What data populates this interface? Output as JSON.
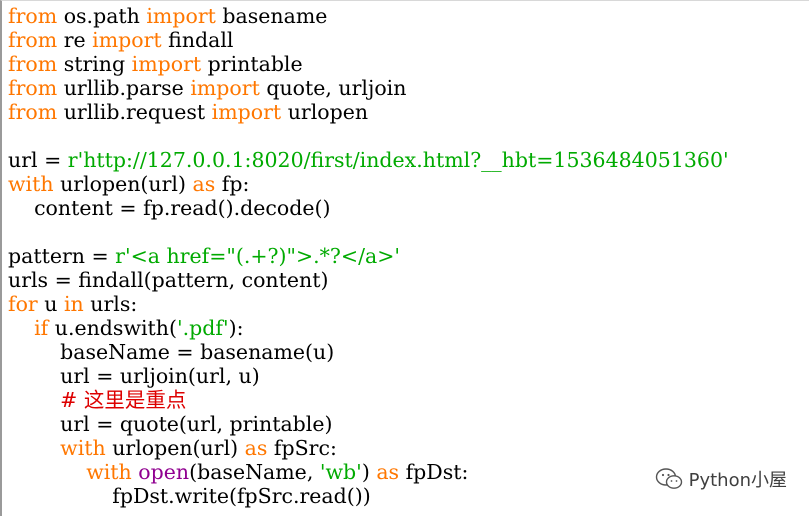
{
  "colors": {
    "keyword": "#ff7700",
    "string": "#00aa00",
    "builtin": "#900090",
    "comment": "#dd0000",
    "plain": "#000000",
    "background": "#ffffff"
  },
  "code": {
    "lines": [
      [
        {
          "t": "from",
          "c": "kw"
        },
        {
          "t": " os.path ",
          "c": "plain"
        },
        {
          "t": "import",
          "c": "kw"
        },
        {
          "t": " basename",
          "c": "plain"
        }
      ],
      [
        {
          "t": "from",
          "c": "kw"
        },
        {
          "t": " re ",
          "c": "plain"
        },
        {
          "t": "import",
          "c": "kw"
        },
        {
          "t": " findall",
          "c": "plain"
        }
      ],
      [
        {
          "t": "from",
          "c": "kw"
        },
        {
          "t": " string ",
          "c": "plain"
        },
        {
          "t": "import",
          "c": "kw"
        },
        {
          "t": " printable",
          "c": "plain"
        }
      ],
      [
        {
          "t": "from",
          "c": "kw"
        },
        {
          "t": " urllib.parse ",
          "c": "plain"
        },
        {
          "t": "import",
          "c": "kw"
        },
        {
          "t": " quote, urljoin",
          "c": "plain"
        }
      ],
      [
        {
          "t": "from",
          "c": "kw"
        },
        {
          "t": " urllib.request ",
          "c": "plain"
        },
        {
          "t": "import",
          "c": "kw"
        },
        {
          "t": " urlopen",
          "c": "plain"
        }
      ],
      [],
      [
        {
          "t": "url = ",
          "c": "plain"
        },
        {
          "t": "r'http://127.0.0.1:8020/first/index.html?__hbt=1536484051360'",
          "c": "str"
        }
      ],
      [
        {
          "t": "with",
          "c": "kw"
        },
        {
          "t": " urlopen(url) ",
          "c": "plain"
        },
        {
          "t": "as",
          "c": "kw"
        },
        {
          "t": " fp:",
          "c": "plain"
        }
      ],
      [
        {
          "t": "    content = fp.read().decode()",
          "c": "plain"
        }
      ],
      [],
      [
        {
          "t": "pattern = ",
          "c": "plain"
        },
        {
          "t": "r'<a href=\"(.+?)\">.*?</a>'",
          "c": "str"
        }
      ],
      [
        {
          "t": "urls = findall(pattern, content)",
          "c": "plain"
        }
      ],
      [
        {
          "t": "for",
          "c": "kw"
        },
        {
          "t": " u ",
          "c": "plain"
        },
        {
          "t": "in",
          "c": "kw"
        },
        {
          "t": " urls:",
          "c": "plain"
        }
      ],
      [
        {
          "t": "    ",
          "c": "plain"
        },
        {
          "t": "if",
          "c": "kw"
        },
        {
          "t": " u.endswith(",
          "c": "plain"
        },
        {
          "t": "'.pdf'",
          "c": "str"
        },
        {
          "t": "):",
          "c": "plain"
        }
      ],
      [
        {
          "t": "        baseName = basename(u)",
          "c": "plain"
        }
      ],
      [
        {
          "t": "        url = urljoin(url, u)",
          "c": "plain"
        }
      ],
      [
        {
          "t": "        ",
          "c": "plain"
        },
        {
          "t": "# 这里是重点",
          "c": "comment"
        }
      ],
      [
        {
          "t": "        url = quote(url, printable)",
          "c": "plain"
        }
      ],
      [
        {
          "t": "        ",
          "c": "plain"
        },
        {
          "t": "with",
          "c": "kw"
        },
        {
          "t": " urlopen(url) ",
          "c": "plain"
        },
        {
          "t": "as",
          "c": "kw"
        },
        {
          "t": " fpSrc:",
          "c": "plain"
        }
      ],
      [
        {
          "t": "            ",
          "c": "plain"
        },
        {
          "t": "with",
          "c": "kw"
        },
        {
          "t": " ",
          "c": "plain"
        },
        {
          "t": "open",
          "c": "builtin"
        },
        {
          "t": "(baseName, ",
          "c": "plain"
        },
        {
          "t": "'wb'",
          "c": "str"
        },
        {
          "t": ") ",
          "c": "plain"
        },
        {
          "t": "as",
          "c": "kw"
        },
        {
          "t": " fpDst:",
          "c": "plain"
        }
      ],
      [
        {
          "t": "                fpDst.write(fpSrc.read())",
          "c": "plain"
        }
      ]
    ]
  },
  "watermark": {
    "icon": "wechat-icon",
    "text": "Python小屋"
  }
}
